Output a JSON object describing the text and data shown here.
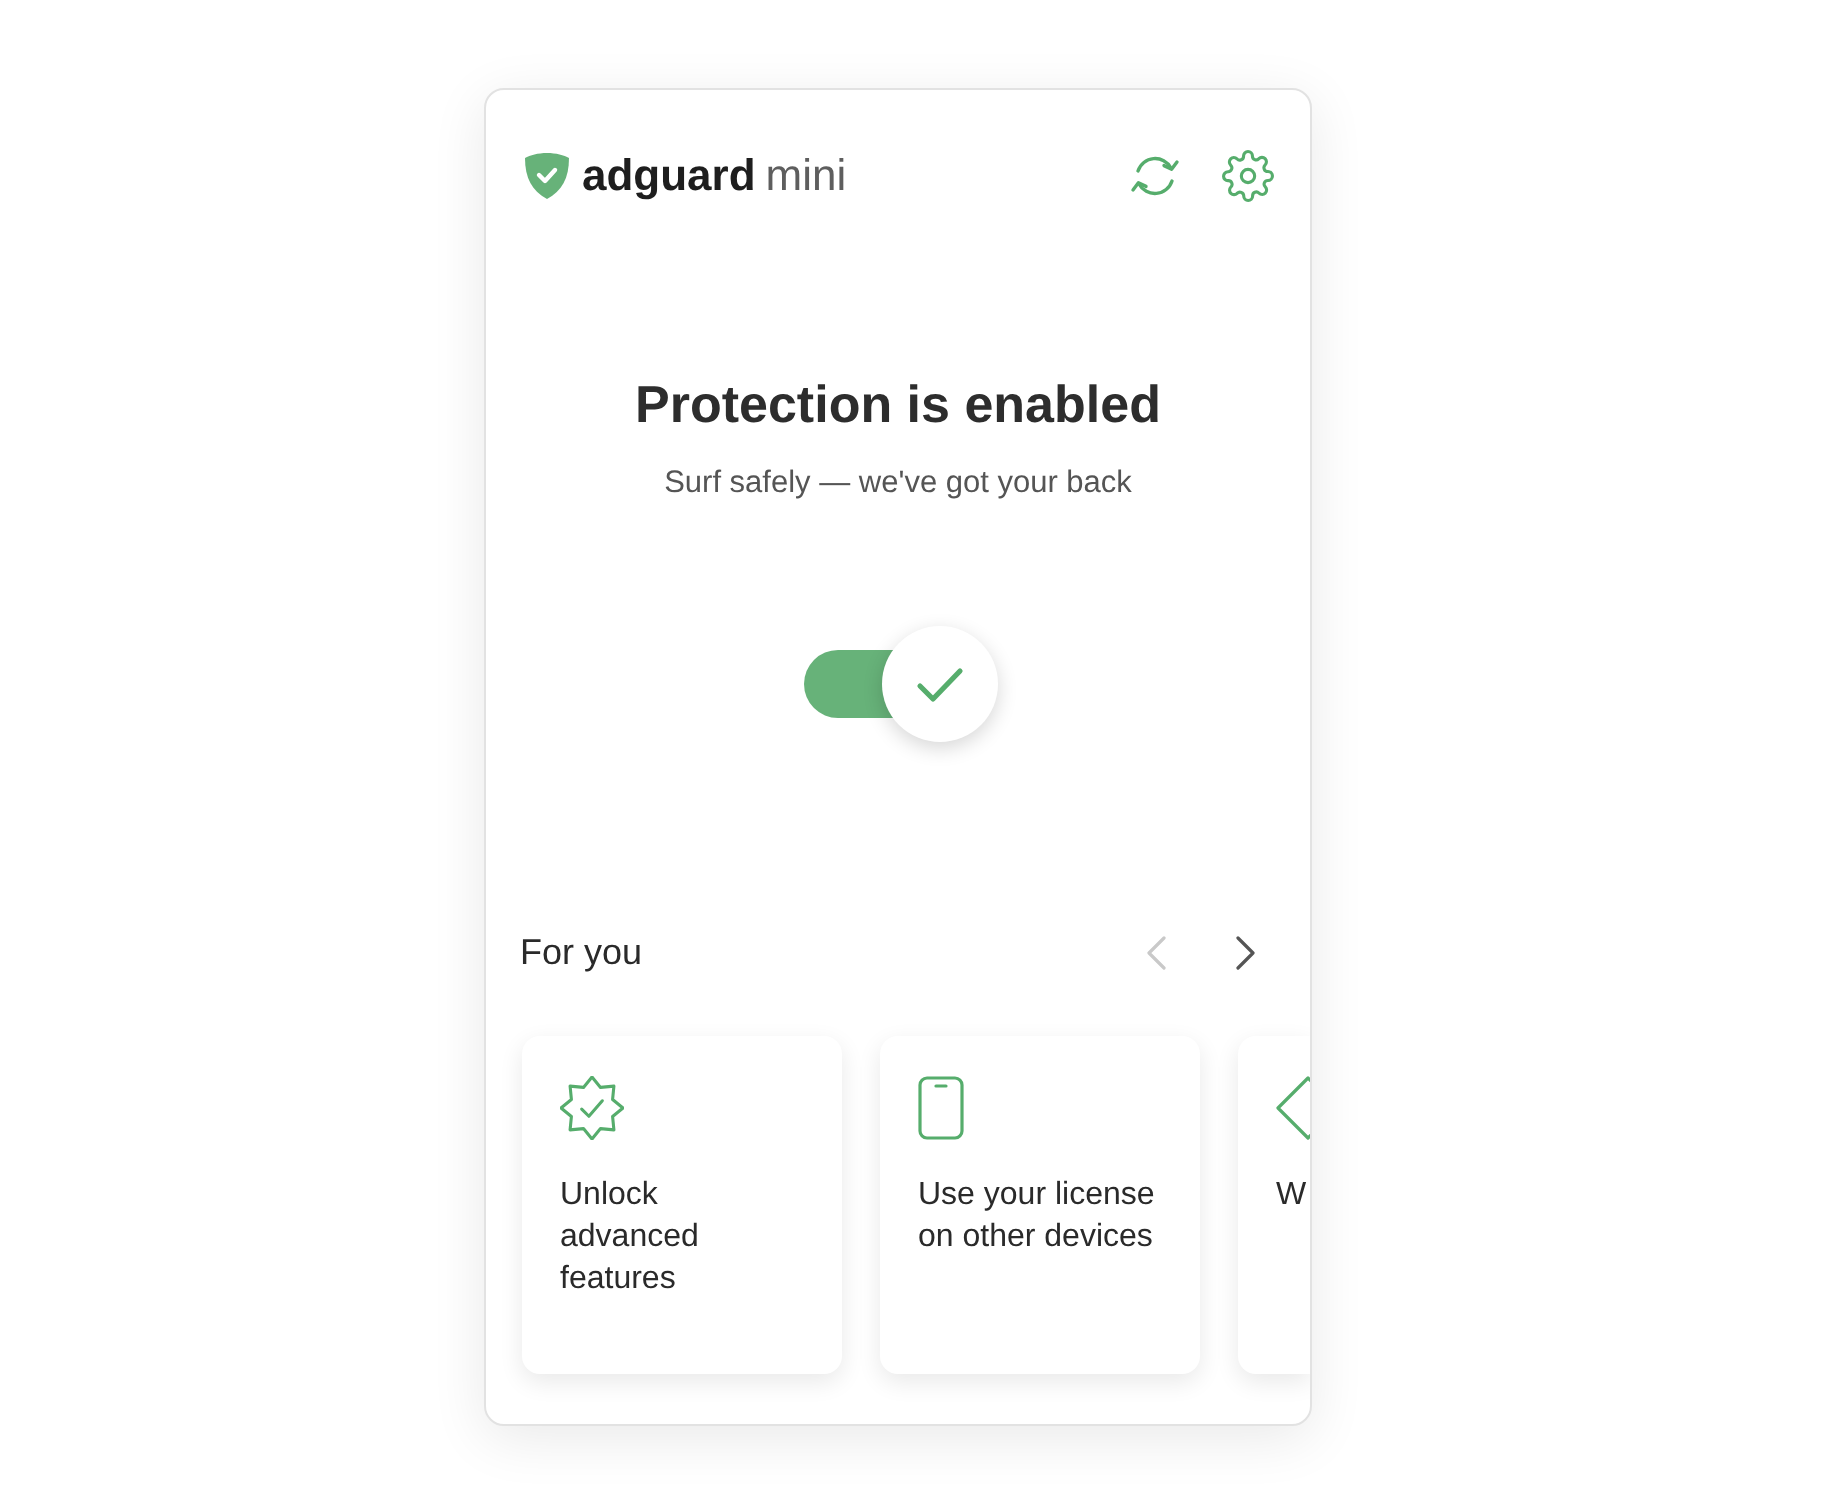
{
  "header": {
    "brand": "adguard",
    "product": "mini"
  },
  "status": {
    "title": "Protection is enabled",
    "subtitle": "Surf safely — we've got your back"
  },
  "protection_toggle": {
    "on": true
  },
  "for_you": {
    "title": "For you",
    "prev": {
      "disabled": true
    },
    "next": {
      "disabled": false
    },
    "cards": [
      {
        "kind": "badge",
        "text": "Unlock advanced features"
      },
      {
        "kind": "phone",
        "text": "Use your license on other devices"
      },
      {
        "kind": "diamond",
        "text": "W"
      }
    ]
  }
}
